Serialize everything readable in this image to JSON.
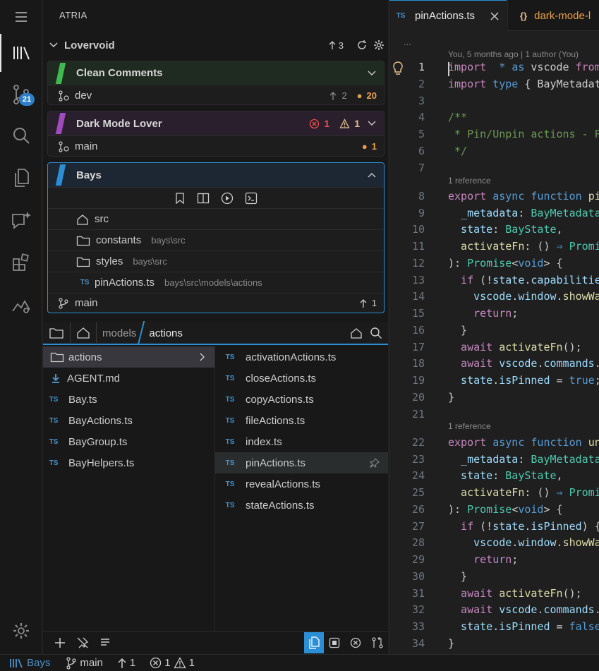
{
  "sidebar": {
    "title": "ATRIA",
    "section": {
      "name": "Lovervoid",
      "ahead": "3"
    },
    "bays": [
      {
        "name": "Clean Comments",
        "color": "#3fb950",
        "branch": "dev",
        "ahead": "2",
        "changes": "20"
      },
      {
        "name": "Dark Mode Lover",
        "color": "#a04bbd",
        "branch": "main",
        "errors": "1",
        "warnings": "1",
        "changes": "1"
      },
      {
        "name": "Bays",
        "color": "#2c8fd6",
        "branch": "main",
        "ahead": "1",
        "items": [
          {
            "name": "src",
            "path": ""
          },
          {
            "name": "constants",
            "path": "bays\\src"
          },
          {
            "name": "styles",
            "path": "bays\\src"
          },
          {
            "name": "pinActions.ts",
            "path": "bays\\src\\models\\actions",
            "badge": "TS"
          }
        ]
      }
    ],
    "breadcrumb": {
      "segment1": "models",
      "segment2": "actions"
    },
    "left_list": [
      {
        "name": "actions",
        "type": "folder"
      },
      {
        "name": "AGENT.md",
        "type": "md"
      },
      {
        "name": "Bay.ts",
        "type": "ts"
      },
      {
        "name": "BayActions.ts",
        "type": "ts"
      },
      {
        "name": "BayGroup.ts",
        "type": "ts"
      },
      {
        "name": "BayHelpers.ts",
        "type": "ts"
      }
    ],
    "right_list": [
      "activationActions.ts",
      "closeActions.ts",
      "copyActions.ts",
      "fileActions.ts",
      "index.ts",
      "pinActions.ts",
      "revealActions.ts",
      "stateActions.ts"
    ],
    "ts_badge": "TS"
  },
  "activity": {
    "scm_badge": "21"
  },
  "editor": {
    "tabs": [
      {
        "label": "pinActions.ts",
        "badge": "TS"
      },
      {
        "label": "dark-mode-l",
        "badge": "{}"
      }
    ],
    "more": "...",
    "blame": "You, 5 months ago | 1 author (You)",
    "reference": "1 reference",
    "lines": [
      {
        "n": "1",
        "tokens": [
          [
            "kw2",
            "import"
          ],
          [
            "",
            "  "
          ],
          [
            "kw",
            "*"
          ],
          [
            "",
            " "
          ],
          [
            "kw",
            "as"
          ],
          [
            "",
            " vscode "
          ],
          [
            "kw2",
            "from"
          ],
          [
            "str",
            " '"
          ]
        ]
      },
      {
        "n": "2",
        "tokens": [
          [
            "kw2",
            "import"
          ],
          [
            "",
            " "
          ],
          [
            "kw",
            "type"
          ],
          [
            "",
            " { BayMetadata"
          ]
        ]
      },
      {
        "n": "3",
        "tokens": []
      },
      {
        "n": "4",
        "tokens": [
          [
            "cm",
            "/**"
          ]
        ]
      },
      {
        "n": "5",
        "tokens": [
          [
            "cm",
            " * Pin/Unpin actions - Pi"
          ]
        ]
      },
      {
        "n": "6",
        "tokens": [
          [
            "cm",
            " */"
          ]
        ]
      },
      {
        "n": "7",
        "tokens": []
      },
      {
        "n": "8",
        "tokens": [
          [
            "kw2",
            "export"
          ],
          [
            "",
            " "
          ],
          [
            "kw",
            "async"
          ],
          [
            "",
            " "
          ],
          [
            "kw",
            "function"
          ],
          [
            "",
            " "
          ],
          [
            "fn",
            "pin"
          ]
        ]
      },
      {
        "n": "9",
        "tokens": [
          [
            "",
            ""
          ],
          [
            "var",
            "  _metadata"
          ],
          [
            "",
            ": "
          ],
          [
            "ty",
            "BayMetadata"
          ],
          [
            "",
            ","
          ]
        ]
      },
      {
        "n": "10",
        "tokens": [
          [
            "var",
            "  state"
          ],
          [
            "",
            ": "
          ],
          [
            "ty",
            "BayState"
          ],
          [
            "",
            ","
          ]
        ]
      },
      {
        "n": "11",
        "tokens": [
          [
            "fn",
            "  activateFn"
          ],
          [
            "",
            ": () "
          ],
          [
            "kw",
            "⇒"
          ],
          [
            "",
            " "
          ],
          [
            "ty",
            "Promi"
          ]
        ]
      },
      {
        "n": "12",
        "tokens": [
          [
            "",
            "): "
          ],
          [
            "ty",
            "Promise"
          ],
          [
            "",
            "<"
          ],
          [
            "kw",
            "void"
          ],
          [
            "",
            "> {"
          ]
        ]
      },
      {
        "n": "13",
        "tokens": [
          [
            "kw2",
            "  if"
          ],
          [
            "",
            " (!"
          ],
          [
            "var",
            "state"
          ],
          [
            "",
            "."
          ],
          [
            "var",
            "capabilities"
          ]
        ]
      },
      {
        "n": "14",
        "tokens": [
          [
            "var",
            "    vscode"
          ],
          [
            "",
            "."
          ],
          [
            "var",
            "window"
          ],
          [
            "",
            "."
          ],
          [
            "fn",
            "showWar"
          ]
        ]
      },
      {
        "n": "15",
        "tokens": [
          [
            "kw2",
            "    return"
          ],
          [
            "",
            ";"
          ]
        ]
      },
      {
        "n": "16",
        "tokens": [
          [
            "",
            "  }"
          ]
        ]
      },
      {
        "n": "17",
        "tokens": [
          [
            "kw2",
            "  await"
          ],
          [
            "",
            " "
          ],
          [
            "fn",
            "activateFn"
          ],
          [
            "",
            "();"
          ]
        ]
      },
      {
        "n": "18",
        "tokens": [
          [
            "kw2",
            "  await"
          ],
          [
            "",
            " "
          ],
          [
            "var",
            "vscode"
          ],
          [
            "",
            "."
          ],
          [
            "var",
            "commands"
          ],
          [
            "",
            ".e"
          ]
        ]
      },
      {
        "n": "19",
        "tokens": [
          [
            "var",
            "  state"
          ],
          [
            "",
            "."
          ],
          [
            "var",
            "isPinned"
          ],
          [
            "",
            " = "
          ],
          [
            "kw",
            "true"
          ],
          [
            "",
            ";"
          ]
        ]
      },
      {
        "n": "20",
        "tokens": [
          [
            "",
            "}"
          ]
        ]
      },
      {
        "n": "21",
        "tokens": []
      },
      {
        "n": "22",
        "tokens": [
          [
            "kw2",
            "export"
          ],
          [
            "",
            " "
          ],
          [
            "kw",
            "async"
          ],
          [
            "",
            " "
          ],
          [
            "kw",
            "function"
          ],
          [
            "",
            " "
          ],
          [
            "fn",
            "unp"
          ]
        ]
      },
      {
        "n": "23",
        "tokens": [
          [
            "var",
            "  _metadata"
          ],
          [
            "",
            ": "
          ],
          [
            "ty",
            "BayMetadata"
          ],
          [
            "",
            ","
          ]
        ]
      },
      {
        "n": "24",
        "tokens": [
          [
            "var",
            "  state"
          ],
          [
            "",
            ": "
          ],
          [
            "ty",
            "BayState"
          ],
          [
            "",
            ","
          ]
        ]
      },
      {
        "n": "25",
        "tokens": [
          [
            "fn",
            "  activateFn"
          ],
          [
            "",
            ": () "
          ],
          [
            "kw",
            "⇒"
          ],
          [
            "",
            " "
          ],
          [
            "ty",
            "Promi"
          ]
        ]
      },
      {
        "n": "26",
        "tokens": [
          [
            "",
            "): "
          ],
          [
            "ty",
            "Promise"
          ],
          [
            "",
            "<"
          ],
          [
            "kw",
            "void"
          ],
          [
            "",
            "> {"
          ]
        ]
      },
      {
        "n": "27",
        "tokens": [
          [
            "kw2",
            "  if"
          ],
          [
            "",
            " (!"
          ],
          [
            "var",
            "state"
          ],
          [
            "",
            "."
          ],
          [
            "var",
            "isPinned"
          ],
          [
            "",
            ") {"
          ]
        ]
      },
      {
        "n": "28",
        "tokens": [
          [
            "var",
            "    vscode"
          ],
          [
            "",
            "."
          ],
          [
            "var",
            "window"
          ],
          [
            "",
            "."
          ],
          [
            "fn",
            "showWar"
          ]
        ]
      },
      {
        "n": "29",
        "tokens": [
          [
            "kw2",
            "    return"
          ],
          [
            "",
            ";"
          ]
        ]
      },
      {
        "n": "30",
        "tokens": [
          [
            "",
            "  }"
          ]
        ]
      },
      {
        "n": "31",
        "tokens": [
          [
            "kw2",
            "  await"
          ],
          [
            "",
            " "
          ],
          [
            "fn",
            "activateFn"
          ],
          [
            "",
            "();"
          ]
        ]
      },
      {
        "n": "32",
        "tokens": [
          [
            "kw2",
            "  await"
          ],
          [
            "",
            " "
          ],
          [
            "var",
            "vscode"
          ],
          [
            "",
            "."
          ],
          [
            "var",
            "commands"
          ],
          [
            "",
            ".e"
          ]
        ]
      },
      {
        "n": "33",
        "tokens": [
          [
            "var",
            "  state"
          ],
          [
            "",
            "."
          ],
          [
            "var",
            "isPinned"
          ],
          [
            "",
            " = "
          ],
          [
            "kw",
            "false"
          ],
          [
            "",
            ";"
          ]
        ]
      },
      {
        "n": "34",
        "tokens": [
          [
            "",
            "}"
          ]
        ]
      }
    ]
  },
  "status": {
    "app": "Bays",
    "branch": "main",
    "ahead": "1",
    "errors": "1",
    "warnings": "1"
  }
}
